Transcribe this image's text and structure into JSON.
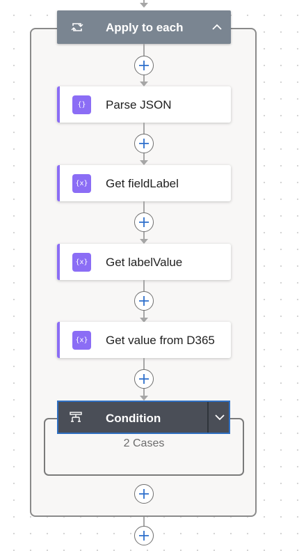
{
  "loop": {
    "title": "Apply to each",
    "icon": "loop-icon",
    "collapse_icon": "chevron-up-icon"
  },
  "actions": [
    {
      "label": "Parse JSON",
      "icon_glyph": "{}",
      "icon": "parse-json-icon"
    },
    {
      "label": "Get fieldLabel",
      "icon_glyph": "{x}",
      "icon": "compose-icon"
    },
    {
      "label": "Get labelValue",
      "icon_glyph": "{x}",
      "icon": "compose-icon"
    },
    {
      "label": "Get value from D365",
      "icon_glyph": "{x}",
      "icon": "compose-icon"
    }
  ],
  "condition": {
    "title": "Condition",
    "cases": "2 Cases",
    "icon": "condition-icon",
    "expand_icon": "chevron-down-icon"
  },
  "colors": {
    "action_accent": "#8b6df5",
    "loop_header": "#7a8591",
    "condition_header": "#4a4e57",
    "selected_border": "#2f6fc1",
    "plus": "#2d6fcb"
  }
}
